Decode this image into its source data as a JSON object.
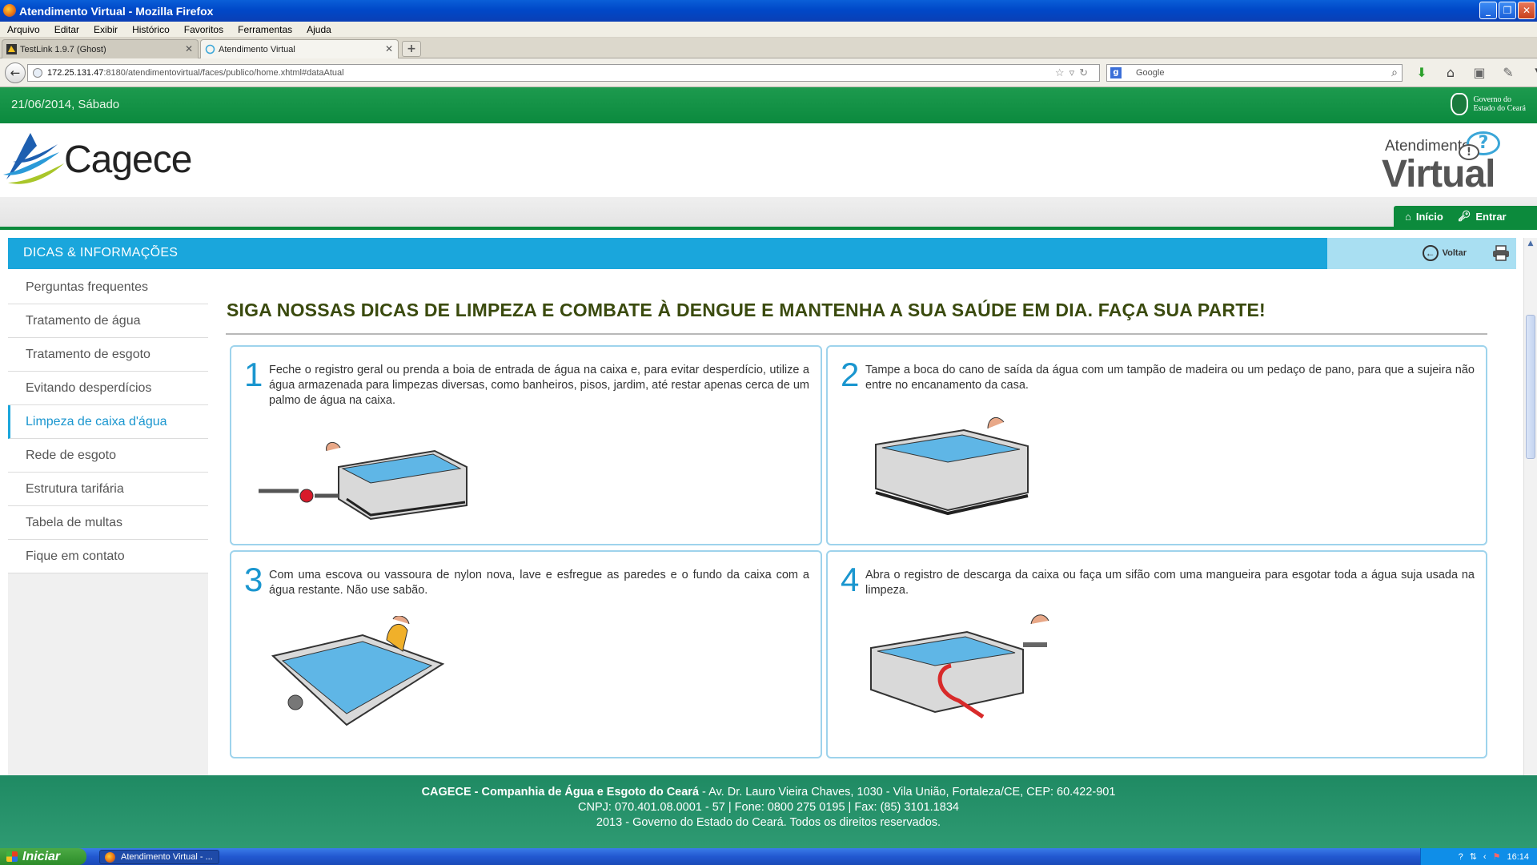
{
  "window": {
    "title": "Atendimento Virtual - Mozilla Firefox"
  },
  "menu": [
    "Arquivo",
    "Editar",
    "Exibir",
    "Histórico",
    "Favoritos",
    "Ferramentas",
    "Ajuda"
  ],
  "tabs": [
    {
      "label": "TestLink 1.9.7 (Ghost)"
    },
    {
      "label": "Atendimento Virtual"
    }
  ],
  "nav": {
    "url_host": "172.25.131.47",
    "url_rest": ":8180/atendimentovirtual/faces/publico/home.xhtml#dataAtual",
    "search_placeholder": "Google"
  },
  "site": {
    "date": "21/06/2014, Sábado",
    "gov_line1": "Governo do",
    "gov_line2": "Estado do Ceará",
    "logo_text": "Cagece",
    "av_line1": "Atendimento",
    "av_line2": "Virtual",
    "topnav": {
      "inicio": "Início",
      "entrar": "Entrar"
    }
  },
  "section": {
    "title": "DICAS & INFORMAÇÕES",
    "voltar": "Voltar"
  },
  "sidebar": {
    "items": [
      {
        "label": "Perguntas frequentes"
      },
      {
        "label": "Tratamento de água"
      },
      {
        "label": "Tratamento de esgoto"
      },
      {
        "label": "Evitando desperdícios"
      },
      {
        "label": "Limpeza de caixa d'água",
        "active": true
      },
      {
        "label": "Rede de esgoto"
      },
      {
        "label": "Estrutura tarifária"
      },
      {
        "label": "Tabela de multas"
      },
      {
        "label": "Fique em contato"
      }
    ]
  },
  "main": {
    "headline": "SIGA NOSSAS DICAS DE LIMPEZA E COMBATE À DENGUE E MANTENHA A SUA SAÚDE EM DIA. FAÇA SUA PARTE!",
    "steps": [
      {
        "num": "1",
        "text": "Feche o registro geral ou prenda a boia de entrada de água na caixa e, para evitar desperdício, utilize a água armazenada para limpezas diversas, como banheiros, pisos, jardim, até restar apenas cerca de um palmo de água na caixa."
      },
      {
        "num": "2",
        "text": "Tampe a boca do cano de saída da água com um tampão de madeira ou um pedaço de pano, para que a sujeira não entre no encanamento da casa."
      },
      {
        "num": "3",
        "text": "Com uma escova ou vassoura de nylon nova, lave e esfregue as paredes e o fundo da caixa com a água restante. Não use sabão."
      },
      {
        "num": "4",
        "text": "Abra o registro de descarga da caixa ou faça um sifão com uma mangueira para esgotar toda a água suja usada na limpeza."
      }
    ]
  },
  "footer": {
    "company": "CAGECE - Companhia de Água e Esgoto do Ceará",
    "address": " - Av. Dr. Lauro Vieira Chaves, 1030 - Vila União, Fortaleza/CE, CEP: 60.422-901",
    "line2": "CNPJ: 070.401.08.0001 - 57 | Fone: 0800 275 0195 | Fax: (85) 3101.1834",
    "line3": "2013 - Governo do Estado do Ceará. Todos os direitos reservados."
  },
  "taskbar": {
    "start": "Iniciar",
    "item": "Atendimento Virtual - ...",
    "clock": "16:14"
  },
  "colors": {
    "green": "#0c8a3c",
    "blue": "#1aa6dc",
    "headline": "#3a4a0e"
  }
}
